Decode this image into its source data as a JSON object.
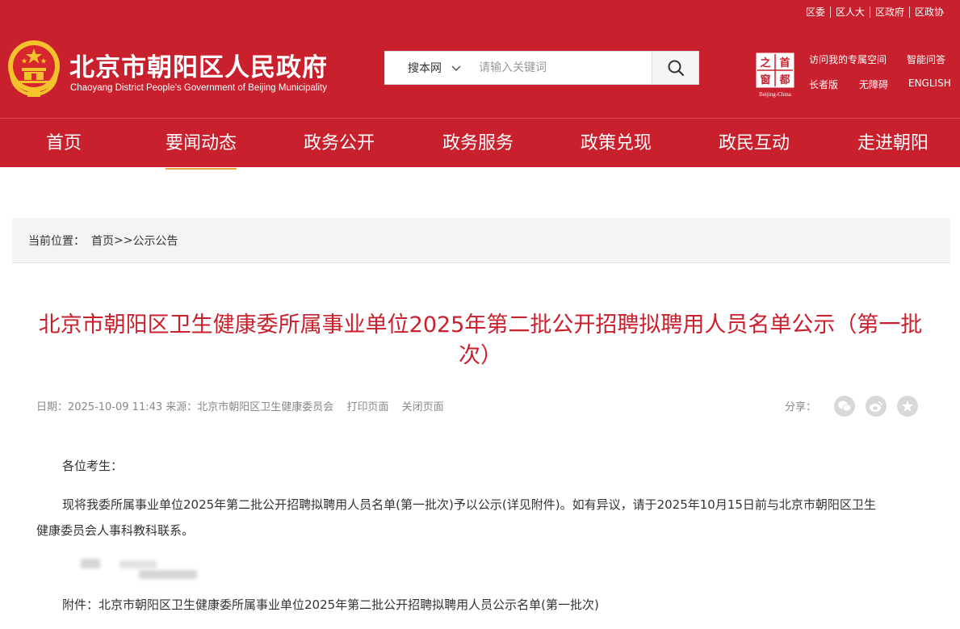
{
  "top_links": [
    "区委",
    "区人大",
    "区政府",
    "区政协"
  ],
  "site": {
    "name": "北京市朝阳区人民政府",
    "name_en": "Chaoyang District People's Government of Beijing Municipality"
  },
  "search": {
    "scope": "搜本网",
    "placeholder": "请输入关键词"
  },
  "capital_logo": {
    "chars": [
      "首",
      "都",
      "之",
      "窗"
    ],
    "caption": "Beijing-China"
  },
  "right_links": {
    "visit": "访问我的专属空间",
    "qa": "智能问答",
    "elder": "长者版",
    "access": "无障碍",
    "english": "ENGLISH"
  },
  "nav": [
    "首页",
    "要闻动态",
    "政务公开",
    "政务服务",
    "政策兑现",
    "政民互动",
    "走进朝阳"
  ],
  "breadcrumb": {
    "label": "当前位置：",
    "home": "首页",
    "sep": ">>",
    "current": "公示公告"
  },
  "article": {
    "title": "北京市朝阳区卫生健康委所属事业单位2025年第二批公开招聘拟聘用人员名单公示（第一批次）",
    "meta_date": "日期：2025-10-09 11:43",
    "meta_source": "来源：北京市朝阳区卫生健康委员会",
    "print": "打印页面",
    "close": "关闭页面",
    "share_label": "分享：",
    "greeting": "各位考生：",
    "body_line1": "现将我委所属事业单位2025年第二批公开招聘拟聘用人员名单(第一批次)予以公示(详见附件)。如有异议，请于2025年10月15日前与北京市朝阳区卫生",
    "body_line2": "健康委员会人事科教科联系。",
    "attachment": "附件：北京市朝阳区卫生健康委所属事业单位2025年第二批公开招聘拟聘用人员公示名单(第一批次)"
  },
  "colors": {
    "brand_red": "#c8202d",
    "nav_active_underline": "#f2a13a",
    "breadcrumb_bg": "#f4f4f4"
  }
}
